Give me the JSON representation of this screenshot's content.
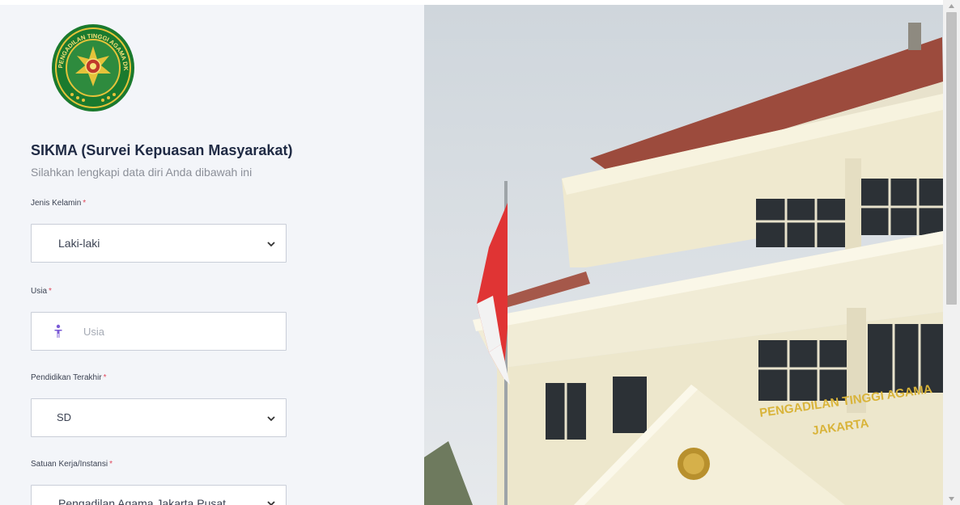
{
  "header": {
    "title": "SIKMA (Survei Kepuasan Masyarakat)",
    "subtitle": "Silahkan lengkapi data diri Anda dibawah ini"
  },
  "logo": {
    "icon": "court-seal-logo",
    "text": "PENGADILAN TINGGI AGAMA DKI JAKARTA",
    "colors": {
      "ring": "#1a7a2e",
      "gold": "#e5c33a"
    }
  },
  "form": {
    "required_marker": "*",
    "jenis_kelamin": {
      "label": "Jenis Kelamin",
      "value": "Laki-laki"
    },
    "usia": {
      "label": "Usia",
      "placeholder": "Usia",
      "icon": "person-icon"
    },
    "pendidikan": {
      "label": "Pendidikan Terakhir",
      "value": "SD"
    },
    "satuan_kerja": {
      "label": "Satuan Kerja/Instansi",
      "value": "Pengadilan Agama Jakarta Pusat"
    }
  },
  "photo": {
    "building_sign_line1": "PENGADILAN TINGGI AGAMA",
    "building_sign_line2": "JAKARTA"
  },
  "theme": {
    "panel_bg": "#f3f5f9",
    "title_color": "#1f2a44",
    "required_color": "#e0475b"
  }
}
